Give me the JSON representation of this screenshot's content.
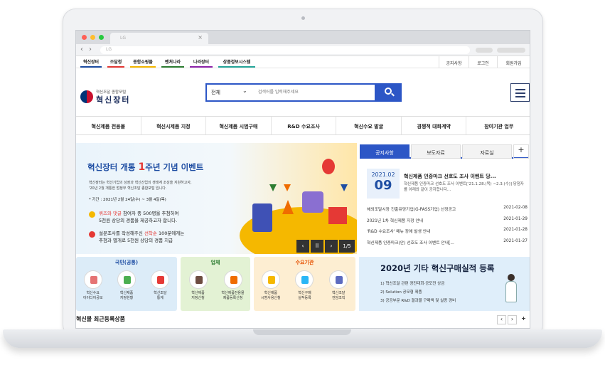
{
  "browser": {
    "tab_title": "LG",
    "tab_close": "×",
    "url": "LG",
    "back": "‹",
    "forward": "›"
  },
  "site_links": [
    "혁신장터",
    "조달청",
    "종합쇼핑몰",
    "벤처나라",
    "나라장터",
    "상품정보시스템"
  ],
  "site_link_colors": [
    "#1f4ea3",
    "#e53935",
    "#f5b800",
    "#2e7d32",
    "#8e24aa",
    "#26a69a"
  ],
  "util_links": [
    "공지사항",
    "로그인",
    "회원가입"
  ],
  "logo": {
    "sub": "혁신조달 종합포털",
    "main": "혁신장터"
  },
  "search": {
    "category": "전체",
    "placeholder": "검색어를 입력해주세요"
  },
  "gnb": [
    "혁신제품 전용몰",
    "혁신시제품 지정",
    "혁신제품 시범구매",
    "R&D 수요조사",
    "혁신수요 발굴",
    "경쟁적 대화계약",
    "참여기관 업무"
  ],
  "banner": {
    "title_a": "혁신장터 개통 ",
    "title_num": "1",
    "title_b": "주년 기념 이벤트",
    "desc1": "혁신장터는 혁신기업의 성장과 혁신산업의 생태계 조성을 지원하고자,",
    "desc2": "'20년 2월 개통한 범정부 혁신조달 종합포털 입니다.",
    "period": "* 기간 : 2021년 2월 24일(수) ~ 3월 4일(목)",
    "e1_hl": "퀴즈와 댓글",
    "e1_rest": " 참여자 중 500명을 추첨하여",
    "e1_line2": "5천원 상당의 경품을 제공하고자 합니다.",
    "e2_a": "설문조사를 작성해주신 ",
    "e2_hl": "선착순",
    "e2_b": " 100분에게는",
    "e2_line2": "추첨과 별개로 5천원 상당의 경품 지급",
    "prev": "‹",
    "pause": "ll",
    "next": "›",
    "page": "1/5"
  },
  "notice": {
    "tabs": [
      "공지사항",
      "보도자료",
      "자료실"
    ],
    "plus": "+",
    "featured": {
      "ym": "2021.02",
      "day": "09",
      "title": "혁신제품 인증마크 선호도 조사 이벤트 당...",
      "desc": "혁신제품 인증마크 선호도 조사 이벤트['21.1.28.(목) ~2.3.(수)] 당첨자를 아래와 같이 공지합니다..."
    },
    "items": [
      {
        "title": "해외조달시장 진출유망기업(G-PASS기업) 선정공고",
        "date": "2021-02-08"
      },
      {
        "title": "2021년 1차 혁신제품 지정 안내",
        "date": "2021-01-29"
      },
      {
        "title": "'R&D 수요조사' 메뉴 장애 발생 안내",
        "date": "2021-01-28"
      },
      {
        "title": "혁신제품 인증마크(안) 선호도 조사 이벤트 안내[...",
        "date": "2021-01-27"
      }
    ]
  },
  "categories": [
    {
      "name": "국민(공통)",
      "bg": "#dcecf8",
      "head_color": "#1f4ea3",
      "items": [
        {
          "l1": "혁신수요",
          "l2": "아이디어공모",
          "color": "#e57373"
        },
        {
          "l1": "혁신제품",
          "l2": "지정현황",
          "color": "#4caf50"
        },
        {
          "l1": "혁신조달",
          "l2": "통계",
          "color": "#e53935"
        }
      ]
    },
    {
      "name": "업체",
      "bg": "#e3f2d4",
      "head_color": "#2e7d32",
      "items": [
        {
          "l1": "혁신제품",
          "l2": "지정신청",
          "color": "#6d4c41"
        },
        {
          "l1": "혁신제품전용몰",
          "l2": "제품등록신청",
          "color": "#ef6c00"
        }
      ]
    },
    {
      "name": "수요기관",
      "bg": "#fdeed2",
      "head_color": "#e65100",
      "items": [
        {
          "l1": "혁신제품",
          "l2": "시범사용신청",
          "color": "#f5b800"
        },
        {
          "l1": "혁신구매",
          "l2": "실적등록",
          "color": "#29b6f6"
        },
        {
          "l1": "혁신조달",
          "l2": "전담조직",
          "color": "#5c6bc0"
        }
      ]
    }
  ],
  "promo": {
    "title": "2020년 기타 혁신구매실적 등록",
    "lines": [
      "1) 혁신조달 관련 경진대회·공모전 상금",
      "2) Solution 공모형 제품",
      "3) 공공부문 R&D 결과물 구매액 및 실증 경비"
    ]
  },
  "recent": {
    "title": "혁신몰 최근등록상품",
    "prev": "‹",
    "next": "›",
    "plus": "+"
  }
}
